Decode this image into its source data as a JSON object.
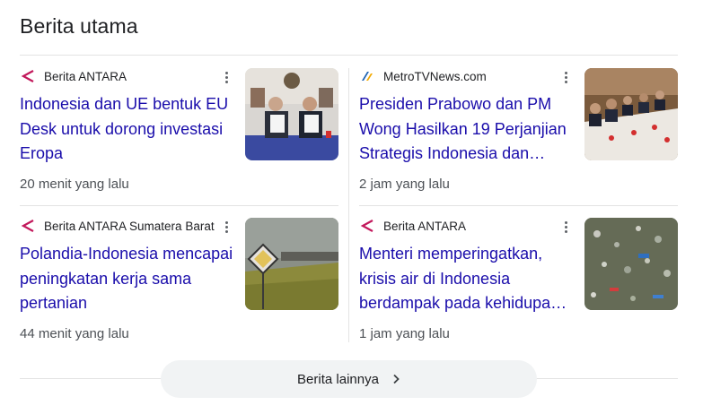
{
  "section": {
    "title": "Berita utama"
  },
  "cards": [
    {
      "source": "Berita ANTARA",
      "source_icon": "antara-logo-icon",
      "headline": "Indonesia dan UE bentuk EU Desk untuk dorong investasi Eropa",
      "time": "20 menit yang lalu",
      "thumbnail": "signing-ceremony-photo"
    },
    {
      "source": "MetroTVNews.com",
      "source_icon": "metrotv-logo-icon",
      "headline": "Presiden Prabowo dan PM Wong Hasilkan 19 Perjanjian Strategis Indonesia dan…",
      "time": "2 jam yang lalu",
      "thumbnail": "bilateral-meeting-photo"
    },
    {
      "source": "Berita ANTARA Sumatera Barat",
      "source_icon": "antara-logo-icon",
      "headline": "Polandia-Indonesia mencapai peningkatan kerja sama pertanian",
      "time": "44 menit yang lalu",
      "thumbnail": "farm-field-photo"
    },
    {
      "source": "Berita ANTARA",
      "source_icon": "antara-logo-icon",
      "headline": "Menteri memperingatkan, krisis air di Indonesia berdampak pada kehidupa…",
      "time": "1 jam yang lalu",
      "thumbnail": "polluted-river-photo"
    }
  ],
  "more_button": {
    "label": "Berita lainnya"
  },
  "colors": {
    "headline_link": "#1a0dab",
    "antara_brand": "#c2185b",
    "button_bg": "#f1f3f4"
  }
}
